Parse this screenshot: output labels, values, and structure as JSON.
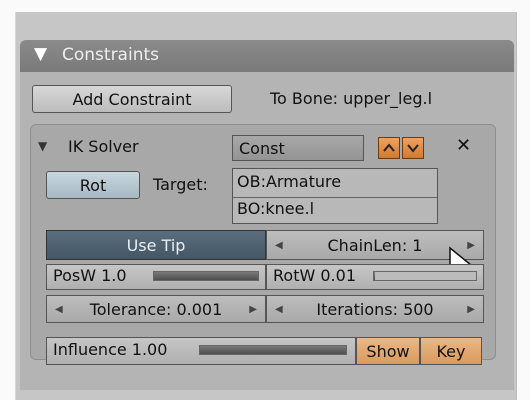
{
  "panel": {
    "title": "Constraints",
    "add_constraint_label": "Add Constraint",
    "to_bone_label": "To Bone: upper_leg.l"
  },
  "constraint": {
    "name": "IK Solver",
    "type_value": "Const",
    "rot_label": "Rot",
    "target_label": "Target:",
    "target_object": "OB:Armature",
    "target_bone": "BO:knee.l",
    "use_tip_label": "Use Tip",
    "chainlen_label": "ChainLen: 1",
    "posw_label": "PosW 1.0",
    "posw_fill": 1.0,
    "rotw_label": "RotW 0.01",
    "rotw_fill": 0.01,
    "tolerance_label": "Tolerance: 0.001",
    "iterations_label": "Iterations: 500"
  },
  "influence": {
    "label": "Influence 1.00",
    "fill": 1.0,
    "show_label": "Show",
    "key_label": "Key"
  },
  "colors": {
    "header_bg": "#7f7f7f",
    "active_button": "#4f6372",
    "accent_orange": "#e08a40"
  }
}
